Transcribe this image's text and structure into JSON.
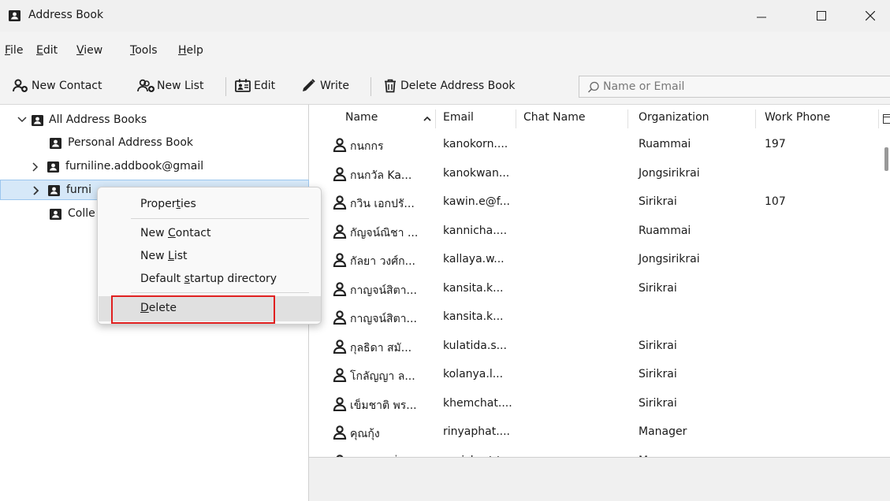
{
  "window": {
    "title": "Address Book"
  },
  "menu": [
    {
      "pre": "",
      "u": "F",
      "post": "ile"
    },
    {
      "pre": "",
      "u": "E",
      "post": "dit"
    },
    {
      "pre": "",
      "u": "V",
      "post": "iew"
    },
    {
      "pre": "",
      "u": "T",
      "post": "ools"
    },
    {
      "pre": "",
      "u": "H",
      "post": "elp"
    }
  ],
  "toolbar": {
    "new_contact": "New Contact",
    "new_list": "New List",
    "edit": "Edit",
    "write": "Write",
    "delete_book": "Delete Address Book"
  },
  "search": {
    "placeholder": "Name or Email"
  },
  "tree": {
    "all": "All Address Books",
    "personal": "Personal Address Book",
    "book1": "furniline.addbook@gmail",
    "book2": "furni",
    "collected": "Colle"
  },
  "columns": {
    "name": "Name",
    "email": "Email",
    "chat": "Chat Name",
    "org": "Organization",
    "phone": "Work Phone"
  },
  "contacts": [
    {
      "name": "กนกกร",
      "email": "kanokorn....",
      "org": "Ruammai",
      "phone": "197"
    },
    {
      "name": "กนกวัล Ka...",
      "email": "kanokwan...",
      "org": "Jongsirikrai",
      "phone": ""
    },
    {
      "name": "กวิน เอกปรั...",
      "email": "kawin.e@f...",
      "org": "Sirikrai",
      "phone": "107"
    },
    {
      "name": "กัญจน์ณิชา ...",
      "email": "kannicha....",
      "org": "Ruammai",
      "phone": ""
    },
    {
      "name": "กัลยา วงศ์ก...",
      "email": "kallaya.w...",
      "org": "Jongsirikrai",
      "phone": ""
    },
    {
      "name": "กาญจน์สิตา...",
      "email": "kansita.k...",
      "org": "Sirikrai",
      "phone": ""
    },
    {
      "name": "กาญจน์สิตา...",
      "email": "kansita.k...",
      "org": "",
      "phone": ""
    },
    {
      "name": "กุลธิดา สมั...",
      "email": "kulatida.s...",
      "org": "Sirikrai",
      "phone": ""
    },
    {
      "name": "โกลัญญา ล...",
      "email": "kolanya.l...",
      "org": "Sirikrai",
      "phone": ""
    },
    {
      "name": "เข็มชาติ พร...",
      "email": "khemchat....",
      "org": "Sirikrai",
      "phone": ""
    },
    {
      "name": "คุณกุ้ง",
      "email": "rinyaphat....",
      "org": "Manager",
      "phone": ""
    },
    {
      "name": "คุณเชอรรี่",
      "email": "parichart.t...",
      "org": "Manager",
      "phone": ""
    }
  ],
  "context_menu": {
    "properties": {
      "pre": "Proper",
      "u": "t",
      "post": "ies"
    },
    "new_contact": {
      "pre": "New ",
      "u": "C",
      "post": "ontact"
    },
    "new_list": {
      "pre": "New ",
      "u": "L",
      "post": "ist"
    },
    "default_dir": {
      "pre": "Default ",
      "u": "s",
      "post": "tartup directory"
    },
    "delete": {
      "pre": "",
      "u": "D",
      "post": "elete"
    }
  }
}
